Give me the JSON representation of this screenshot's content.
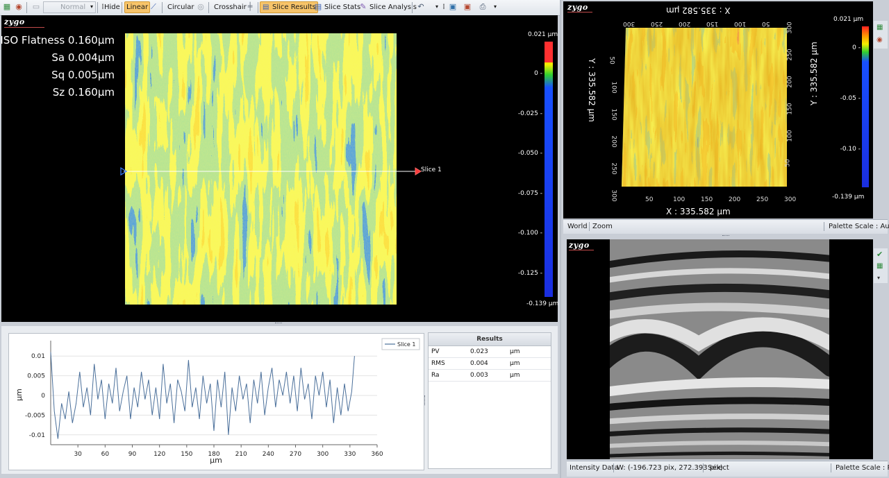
{
  "toolbar": {
    "normal": "Normal",
    "hide": "Hide",
    "linear": "Linear",
    "circular": "Circular",
    "crosshair": "Crosshair",
    "slice_results": "Slice Results",
    "slice_stats": "Slice Stats",
    "slice_analysis": "Slice Analysis"
  },
  "main_view": {
    "logo": "zygo",
    "stats": [
      {
        "label": "ISO Flatness",
        "value": "0.160",
        "unit": "µm"
      },
      {
        "label": "Sa",
        "value": "0.004",
        "unit": "µm"
      },
      {
        "label": "Sq",
        "value": "0.005",
        "unit": "µm"
      },
      {
        "label": "Sz",
        "value": "0.160",
        "unit": "µm"
      }
    ],
    "slice_label": "Slice 1",
    "colorbar": {
      "top_label": "0.021 µm",
      "bottom_label": "-0.139 µm",
      "ticks": [
        "0",
        "-0.025",
        "-0.050",
        "-0.075",
        "-0.100",
        "-0.125"
      ]
    }
  },
  "view3d": {
    "logo": "zygo",
    "x_label": "X : 335.582 µm",
    "y_label": "Y : 335.582 µm",
    "x_ticks": [
      "50",
      "100",
      "150",
      "200",
      "250",
      "300"
    ],
    "y_ticks": [
      "50",
      "100",
      "150",
      "200",
      "250",
      "300"
    ],
    "colorbar": {
      "top_label": "0.021 µm",
      "bottom_label": "-0.139 µm",
      "ticks": [
        "0",
        "-0.05",
        "-0.10"
      ]
    },
    "status": {
      "world": "World",
      "zoom": "Zoom",
      "palette": "Palette Scale : Auto"
    }
  },
  "intensity_view": {
    "logo": "zygo",
    "status": {
      "data": "Intensity Data",
      "coords": "W: (-196.723 pix, 272.393 pix)",
      "select": "Select",
      "palette": "Palette Scale : PV"
    }
  },
  "results": {
    "title": "Results",
    "rows": [
      {
        "name": "PV",
        "value": "0.023",
        "unit": "µm"
      },
      {
        "name": "RMS",
        "value": "0.004",
        "unit": "µm"
      },
      {
        "name": "Ra",
        "value": "0.003",
        "unit": "µm"
      }
    ]
  },
  "chart_data": {
    "type": "line",
    "title": "",
    "xlabel": "µm",
    "ylabel": "µm",
    "xlim": [
      0,
      360
    ],
    "ylim": [
      -0.0125,
      0.0125
    ],
    "x_ticks": [
      30,
      60,
      90,
      120,
      150,
      180,
      210,
      240,
      270,
      300,
      330,
      360
    ],
    "y_ticks": [
      -0.01,
      -0.005,
      0,
      0.005,
      0.01
    ],
    "y_tick_labels": [
      "-0.01",
      "-0.005",
      "0",
      "0.005",
      "0.01"
    ],
    "legend": "top-right",
    "series": [
      {
        "name": "Slice 1",
        "color": "#4a6f9a",
        "x": [
          0,
          4,
          8,
          12,
          16,
          20,
          24,
          28,
          32,
          36,
          40,
          44,
          48,
          52,
          56,
          60,
          64,
          68,
          72,
          76,
          80,
          84,
          88,
          92,
          96,
          100,
          104,
          108,
          112,
          116,
          120,
          124,
          128,
          132,
          136,
          140,
          144,
          148,
          152,
          156,
          160,
          164,
          168,
          172,
          176,
          180,
          184,
          188,
          192,
          196,
          200,
          204,
          208,
          212,
          216,
          220,
          224,
          228,
          232,
          236,
          240,
          244,
          248,
          252,
          256,
          260,
          264,
          268,
          272,
          276,
          280,
          284,
          288,
          292,
          296,
          300,
          304,
          308,
          312,
          316,
          320,
          324,
          328,
          332,
          335
        ],
        "values": [
          0.011,
          -0.004,
          -0.011,
          -0.002,
          -0.006,
          0.001,
          -0.007,
          -0.002,
          0.006,
          -0.003,
          0.002,
          -0.005,
          0.008,
          -0.001,
          0.004,
          -0.006,
          0.003,
          -0.002,
          0.007,
          -0.004,
          0.001,
          0.005,
          -0.006,
          0.002,
          -0.003,
          0.006,
          -0.001,
          0.004,
          -0.005,
          0.002,
          -0.006,
          0.008,
          -0.002,
          0.003,
          -0.007,
          0.004,
          0.001,
          -0.004,
          0.009,
          -0.003,
          0.002,
          -0.006,
          0.005,
          -0.002,
          0.003,
          -0.009,
          0.004,
          -0.003,
          0.006,
          -0.01,
          0.002,
          -0.004,
          0.005,
          -0.001,
          0.003,
          -0.007,
          0.004,
          -0.002,
          0.006,
          -0.005,
          0.002,
          0.007,
          -0.003,
          0.004,
          0.0,
          0.006,
          -0.002,
          0.005,
          -0.004,
          0.007,
          -0.001,
          0.003,
          -0.006,
          0.005,
          0.0,
          0.006,
          -0.003,
          0.004,
          -0.007,
          0.002,
          -0.005,
          0.003,
          -0.004,
          0.001,
          0.01
        ]
      }
    ]
  }
}
